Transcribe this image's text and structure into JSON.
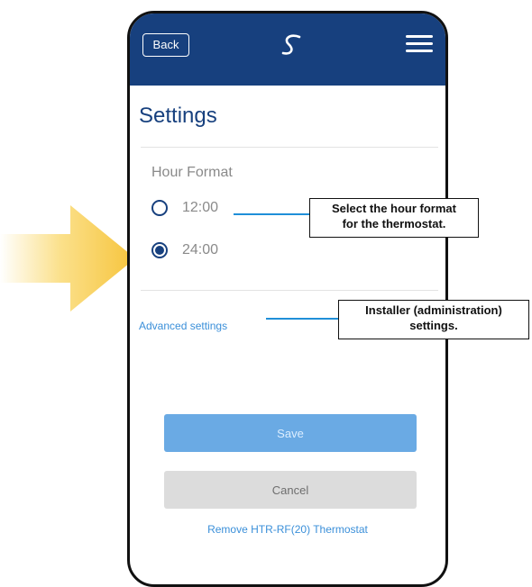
{
  "header": {
    "back_label": "Back",
    "logo_icon": "salus-s-logo",
    "menu_icon": "hamburger-menu-icon"
  },
  "page": {
    "title": "Settings"
  },
  "hour_format": {
    "label": "Hour Format",
    "options": [
      {
        "label": "12:00",
        "selected": false
      },
      {
        "label": "24:00",
        "selected": true
      }
    ]
  },
  "advanced_settings_label": "Advanced settings",
  "buttons": {
    "save_label": "Save",
    "cancel_label": "Cancel"
  },
  "remove_link_label": "Remove HTR-RF(20) Thermostat",
  "annotations": {
    "hour_format_note_line1": "Select the hour format",
    "hour_format_note_line2": "for the thermostat.",
    "advanced_note_line1": "Installer (administration)",
    "advanced_note_line2": "settings."
  },
  "colors": {
    "header_bg": "#17407e",
    "accent_blue": "#3a8fd9",
    "save_button": "#6aaae4",
    "cancel_button": "#dcdcdc",
    "arrow_yellow": "#f6c43c"
  }
}
